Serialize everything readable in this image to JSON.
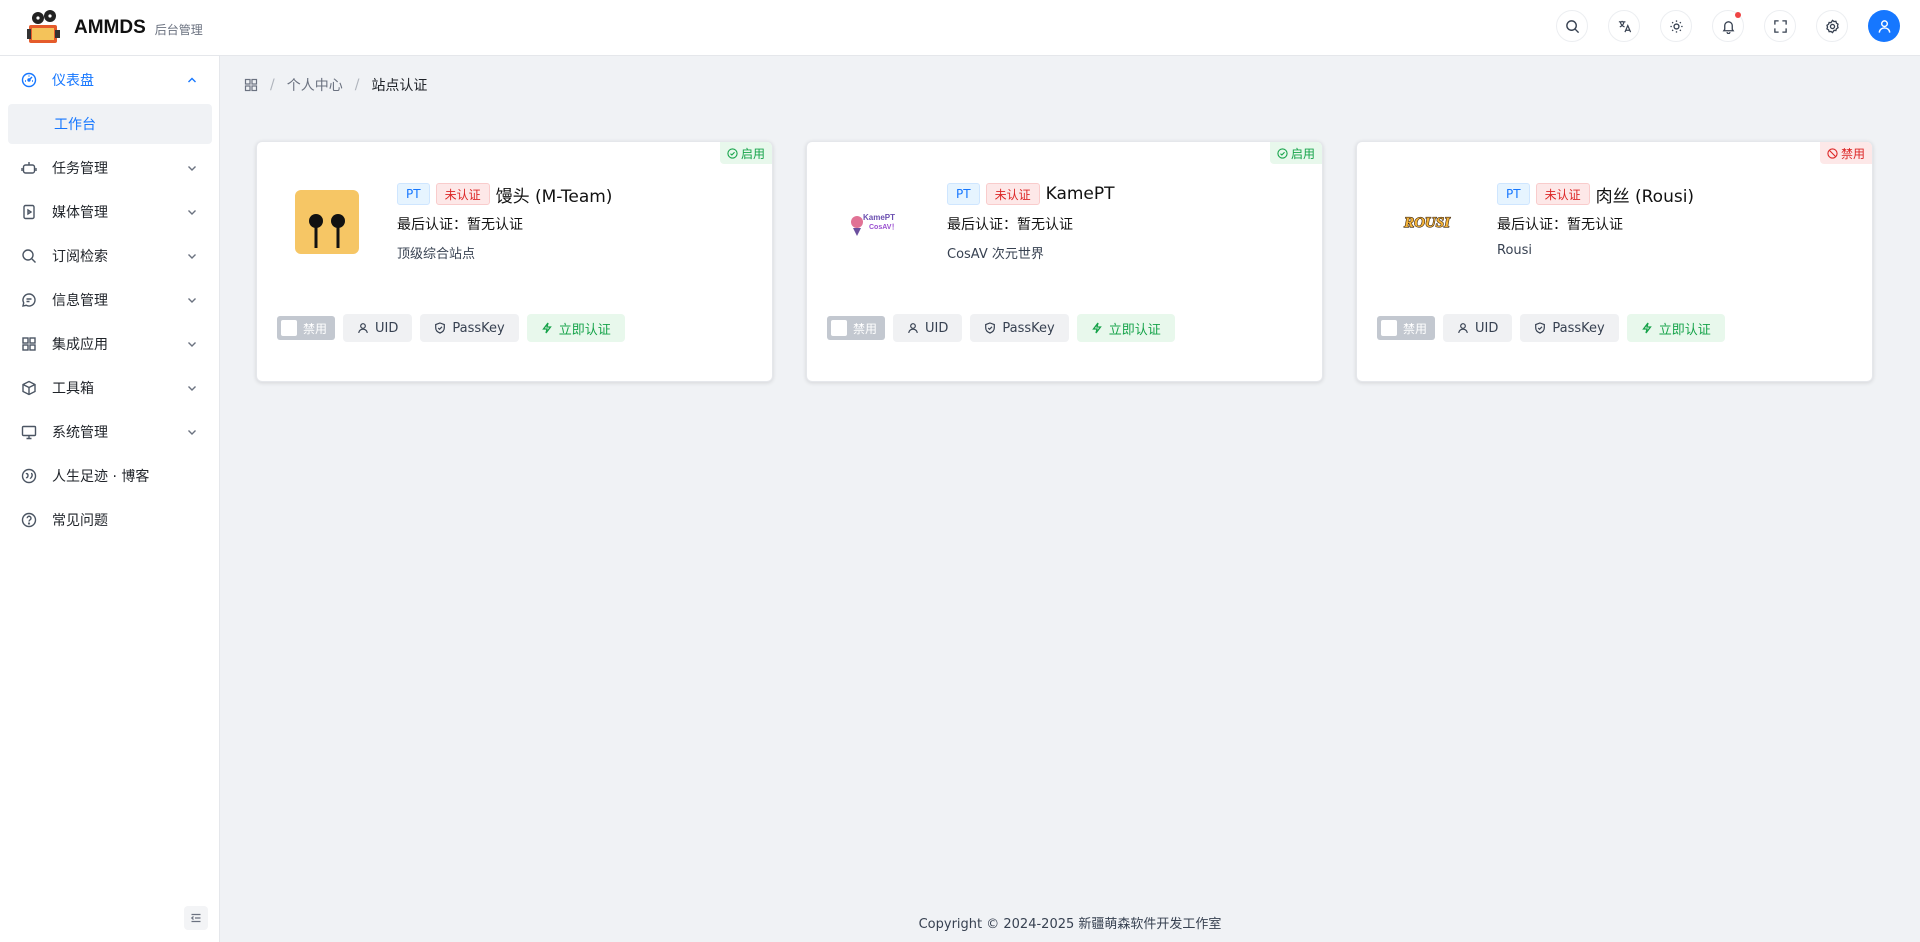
{
  "app": {
    "title": "AMMDS",
    "subtitle": "后台管理"
  },
  "header": {
    "icons": [
      "search-icon",
      "translate-icon",
      "theme-icon",
      "bell-icon",
      "fullscreen-icon",
      "settings-icon"
    ],
    "has_notification": true
  },
  "sidebar": {
    "items": [
      {
        "label": "仪表盘",
        "icon": "dashboard-icon",
        "expanded": true
      },
      {
        "label": "工作台",
        "submenu_of": 0,
        "active": true
      },
      {
        "label": "任务管理",
        "icon": "robot-icon"
      },
      {
        "label": "媒体管理",
        "icon": "media-icon"
      },
      {
        "label": "订阅检索",
        "icon": "search-icon"
      },
      {
        "label": "信息管理",
        "icon": "message-icon"
      },
      {
        "label": "集成应用",
        "icon": "apps-icon"
      },
      {
        "label": "工具箱",
        "icon": "box-icon"
      },
      {
        "label": "系统管理",
        "icon": "monitor-icon"
      },
      {
        "label": "人生足迹 · 博客",
        "icon": "footprint-icon"
      },
      {
        "label": "常见问题",
        "icon": "help-icon"
      }
    ]
  },
  "breadcrumb": {
    "items": [
      "个人中心",
      "站点认证"
    ]
  },
  "cards": [
    {
      "status": "启用",
      "status_type": "enabled",
      "tag_type": "PT",
      "auth_tag": "未认证",
      "name": "馒头 (M-Team)",
      "last_auth_label": "最后认证：",
      "last_auth_value": "暂无认证",
      "description": "顶级综合站点",
      "switch_label": "禁用",
      "uid_label": "UID",
      "passkey_label": "PassKey",
      "auth_button": "立即认证",
      "logo": "mteam-logo"
    },
    {
      "status": "启用",
      "status_type": "enabled",
      "tag_type": "PT",
      "auth_tag": "未认证",
      "name": "KamePT",
      "last_auth_label": "最后认证：",
      "last_auth_value": "暂无认证",
      "description": "CosAV 次元世界",
      "switch_label": "禁用",
      "uid_label": "UID",
      "passkey_label": "PassKey",
      "auth_button": "立即认证",
      "logo": "kamept-logo",
      "logo_text": [
        "KamePT",
        "CosAV！"
      ]
    },
    {
      "status": "禁用",
      "status_type": "disabled",
      "tag_type": "PT",
      "auth_tag": "未认证",
      "name": "肉丝 (Rousi)",
      "last_auth_label": "最后认证：",
      "last_auth_value": "暂无认证",
      "description": "Rousi",
      "switch_label": "禁用",
      "uid_label": "UID",
      "passkey_label": "PassKey",
      "auth_button": "立即认证",
      "logo": "rousi-logo",
      "logo_text": "ROUSI"
    }
  ],
  "footer": {
    "copyright": "Copyright © 2024-2025 新疆萌森软件开发工作室"
  },
  "colors": {
    "accent": "#1677ff",
    "success": "#16a34a",
    "danger": "#dc2626",
    "page_bg": "#f0f2f5"
  }
}
